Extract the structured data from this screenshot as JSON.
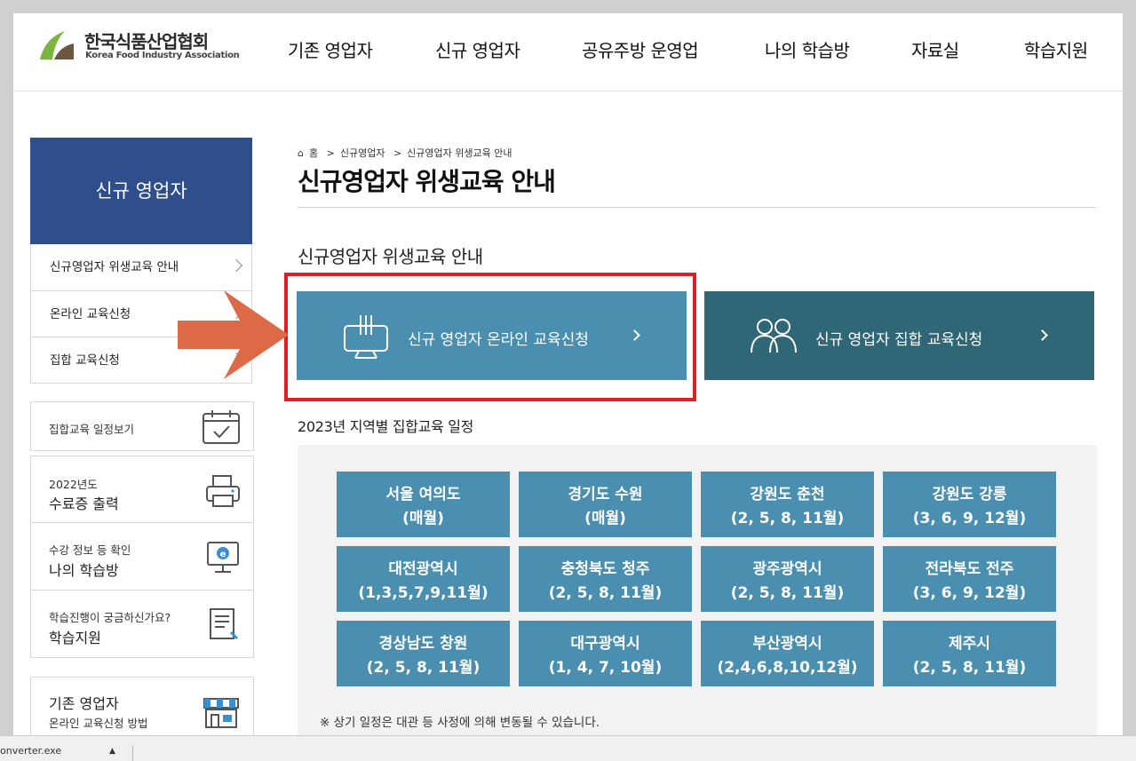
{
  "header": {
    "logo_kr": "한국식품산업협회",
    "logo_en": "Korea Food Industry Association",
    "nav": [
      "기존 영업자",
      "신규 영업자",
      "공유주방 운영업",
      "나의 학습방",
      "자료실",
      "학습지원"
    ]
  },
  "sidebar": {
    "title": "신규 영업자",
    "items": [
      "신규영업자 위생교육 안내",
      "온라인 교육신청",
      "집합 교육신청"
    ],
    "quick": [
      {
        "small": "",
        "big": "집합교육 일정보기",
        "icon": "calendar-icon"
      },
      {
        "small": "2022년도",
        "big": "수료증 출력",
        "icon": "printer-icon"
      },
      {
        "small": "수강 정보 등 확인",
        "big": "나의 학습방",
        "icon": "monitor-e-icon"
      },
      {
        "small": "학습진행이 궁금하신가요?",
        "big": "학습지원",
        "icon": "document-pen-icon"
      },
      {
        "small": "온라인 교육신청 방법",
        "big": "기존 영업자",
        "icon": "store-icon"
      }
    ]
  },
  "breadcrumb": [
    "홈",
    "신규영업자",
    "신규영업자 위생교육 안내"
  ],
  "page_title": "신규영업자 위생교육 안내",
  "section_title": "신규영업자 위생교육 안내",
  "buttons": {
    "online": "신규 영업자 온라인 교육신청",
    "group": "신규 영업자 집합 교육신청"
  },
  "schedule": {
    "title": "2023년 지역별 집합교육 일정",
    "regions": [
      {
        "name": "서울 여의도",
        "months": "(매월)"
      },
      {
        "name": "경기도 수원",
        "months": "(매월)"
      },
      {
        "name": "강원도 춘천",
        "months": "(2, 5, 8, 11월)"
      },
      {
        "name": "강원도 강릉",
        "months": "(3, 6, 9, 12월)"
      },
      {
        "name": "대전광역시",
        "months": "(1,3,5,7,9,11월)"
      },
      {
        "name": "충청북도 청주",
        "months": "(2, 5, 8, 11월)"
      },
      {
        "name": "광주광역시",
        "months": "(2, 5, 8, 11월)"
      },
      {
        "name": "전라북도 전주",
        "months": "(3, 6, 9, 12월)"
      },
      {
        "name": "경상남도 창원",
        "months": "(2, 5, 8, 11월)"
      },
      {
        "name": "대구광역시",
        "months": "(1, 4, 7, 10월)"
      },
      {
        "name": "부산광역시",
        "months": "(2,4,6,8,10,12월)"
      },
      {
        "name": "제주시",
        "months": "(2, 5, 8, 11월)"
      }
    ],
    "note": "※ 상기 일정은 대관 등 사정에 의해 변동될 수 있습니다."
  },
  "taskbar": {
    "file": "onverter.exe"
  },
  "colors": {
    "brand_blue": "#2e4f8b",
    "online_btn": "#4a8fb0",
    "group_btn": "#306776",
    "highlight": "#e01e26",
    "arrow": "#dd6a47"
  }
}
